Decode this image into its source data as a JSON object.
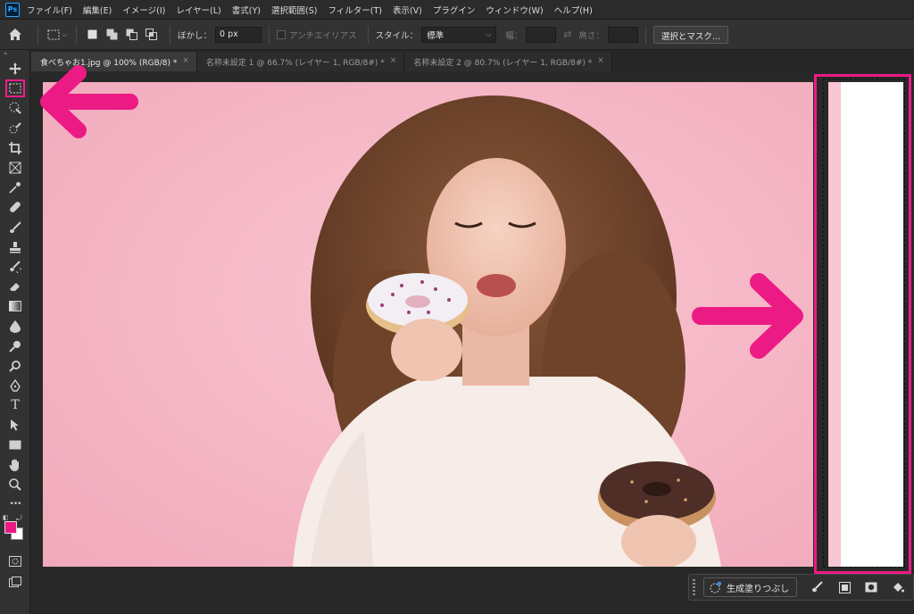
{
  "app": {
    "logo": "Ps"
  },
  "menu": [
    "ファイル(F)",
    "編集(E)",
    "イメージ(I)",
    "レイヤー(L)",
    "書式(Y)",
    "選択範囲(S)",
    "フィルター(T)",
    "表示(V)",
    "プラグイン",
    "ウィンドウ(W)",
    "ヘルプ(H)"
  ],
  "options": {
    "feather_label": "ぼかし：",
    "feather_value": "0 px",
    "antialias_label": "アンチエイリアス",
    "style_label": "スタイル：",
    "style_value": "標準",
    "width_label": "幅：",
    "height_label": "高さ：",
    "select_mask_label": "選択とマスク..."
  },
  "tabs": [
    {
      "label": "食べちゃお1.jpg @ 100% (RGB/8) *",
      "close": "×"
    },
    {
      "label": "名称未設定 1 @ 66.7% (レイヤー 1, RGB/8#) *",
      "close": "×"
    },
    {
      "label": "名称未設定 2 @ 80.7% (レイヤー 1, RGB/8#) *",
      "close": "×"
    }
  ],
  "tools": {
    "text_tool_glyph": "T",
    "more_tools_glyph": "•••",
    "collapse_glyph": "»"
  },
  "colors": {
    "foreground": "#ec1a85",
    "background": "#ffffff",
    "annotation": "#ec1a85"
  },
  "taskbar": {
    "generative_fill_label": "生成塗りつぶし"
  }
}
